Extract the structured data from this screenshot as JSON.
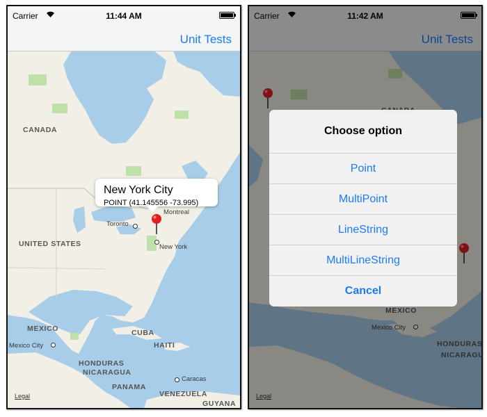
{
  "screens": [
    {
      "status": {
        "carrier": "Carrier",
        "time": "11:44 AM"
      },
      "nav": {
        "right_button": "Unit Tests"
      },
      "map": {
        "regions": [
          "CANADA",
          "UNITED STATES",
          "MEXICO",
          "CUBA",
          "HAITI",
          "HONDURAS",
          "NICARAGUA",
          "PANAMA",
          "VENEZUELA",
          "GUYANA"
        ],
        "cities": [
          "Toronto",
          "Montreal",
          "New York",
          "Mexico City",
          "Caracas"
        ],
        "legal": "Legal"
      },
      "callout": {
        "title": "New York City",
        "subtitle": "POINT (41.145556 -73.995)"
      }
    },
    {
      "status": {
        "carrier": "Carrier",
        "time": "11:42 AM"
      },
      "nav": {
        "right_button": "Unit Tests"
      },
      "map": {
        "regions": [
          "CANADA",
          "MEXICO",
          "HONDURAS",
          "NICARAGUA"
        ],
        "cities": [
          "Mexico City"
        ],
        "legal": "Legal"
      },
      "alert": {
        "title": "Choose option",
        "options": [
          "Point",
          "MultiPoint",
          "LineString",
          "MultiLineString"
        ],
        "cancel": "Cancel"
      }
    }
  ],
  "colors": {
    "accent": "#1a7cf5",
    "water": "#a7cde8",
    "land": "#f1efe6",
    "park": "#bfe0a8",
    "pin": "#e02020"
  }
}
